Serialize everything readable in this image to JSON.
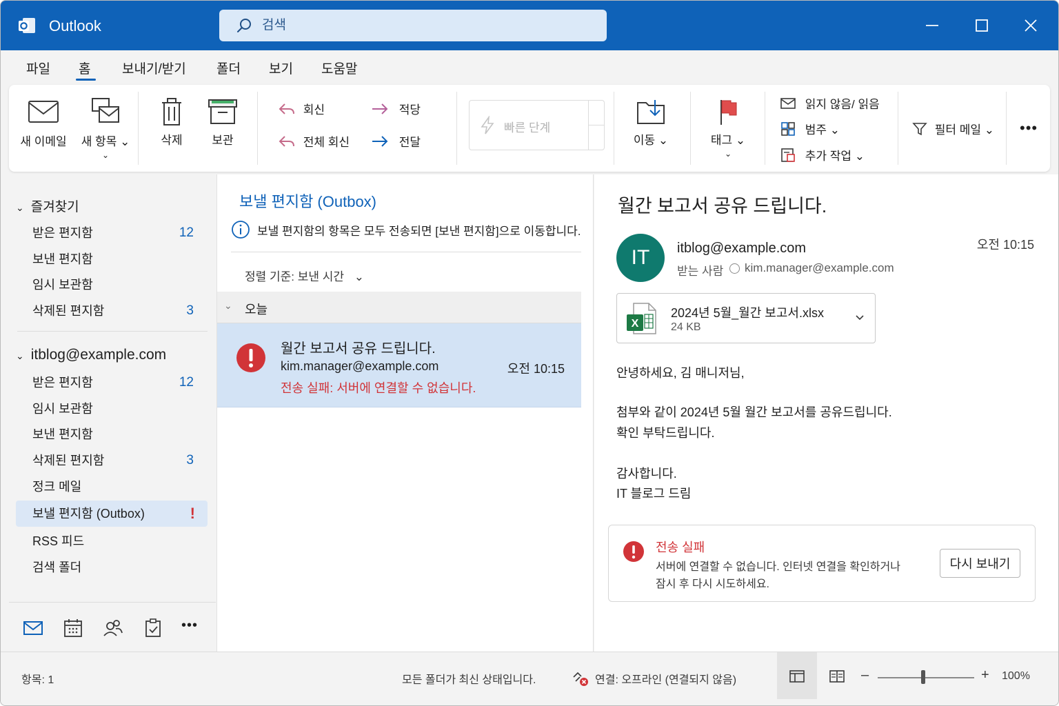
{
  "app": {
    "title": "Outlook"
  },
  "search": {
    "placeholder": "검색"
  },
  "tabs": [
    "파일",
    "홈",
    "보내기/받기",
    "폴더",
    "보기",
    "도움말"
  ],
  "ribbon": {
    "new_email": "새 이메일",
    "new_items": "새 항목",
    "delete": "삭제",
    "archive": "보관",
    "reply": "회신",
    "reply_all": "전체 회신",
    "reply_right": "적당",
    "forward": "전달",
    "quick_steps": "빠른 단계",
    "move": "이동",
    "tags": "태그",
    "unread_read": "읽지 않음/ 읽음",
    "categorize": "범주",
    "more_actions": "추가 작업",
    "filter_mail": "필터 메일"
  },
  "nav": {
    "favorites_header": "즐겨찾기",
    "favorites": [
      {
        "label": "받은 편지함",
        "count": "12"
      },
      {
        "label": "보낸 편지함",
        "count": ""
      },
      {
        "label": "임시 보관함",
        "count": ""
      },
      {
        "label": "삭제된 편지함",
        "count": "3"
      }
    ],
    "account_header": "itblog@example.com",
    "account": [
      {
        "label": "받은 편지함",
        "count": "12"
      },
      {
        "label": "임시 보관함",
        "count": ""
      },
      {
        "label": "보낸 편지함",
        "count": ""
      },
      {
        "label": "삭제된 편지함",
        "count": "3"
      },
      {
        "label": "정크 메일",
        "count": ""
      },
      {
        "label": "보낼 편지함 (Outbox)",
        "count": "!"
      },
      {
        "label": "RSS 피드",
        "count": ""
      },
      {
        "label": "검색 폴더",
        "count": ""
      }
    ]
  },
  "list": {
    "title": "보낼 편지함 (Outbox)",
    "info": "보낼 편지함의 항목은 모두 전송되면 [보낸 편지함]으로 이동합니다.",
    "sort": "정렬 기준: 보낸 시간",
    "group": "오늘",
    "message": {
      "subject": "월간 보고서 공유 드립니다.",
      "from": "kim.manager@example.com",
      "time": "오전 10:15",
      "error": "전송 실패: 서버에 연결할 수 없습니다."
    }
  },
  "reading": {
    "subject": "월간 보고서 공유 드립니다.",
    "avatar": "IT",
    "sender": "itblog@example.com",
    "to_label": "받는 사람",
    "to_addr": "kim.manager@example.com",
    "time": "오전 10:15",
    "attachment": {
      "name": "2024년 5월_월간 보고서.xlsx",
      "size": "24 KB"
    },
    "body": [
      "안녕하세요, 김 매니저님,",
      "첨부와 같이 2024년 5월 월간 보고서를 공유드립니다.",
      "확인 부탁드립니다.",
      "감사합니다.",
      "IT 블로그 드림"
    ],
    "error_title": "전송 실패",
    "error_line1": "서버에 연결할 수 없습니다. 인터넷 연결을 확인하거나",
    "error_line2": "잠시 후 다시 시도하세요.",
    "resend": "다시 보내기"
  },
  "status": {
    "items": "항목: 1",
    "folders": "모든 폴더가 최신 상태입니다.",
    "connection": "연결: 오프라인 (연결되지 않음)",
    "zoom": "100%",
    "zoom_level": 0.47
  },
  "colors": {
    "accent": "#0f62b8",
    "error": "#d13438",
    "avatar": "#0f7a6e",
    "selected_row": "#d3e3f5"
  },
  "icons": [
    "outlook-logo-icon",
    "search-icon",
    "minimize-icon",
    "maximize-icon",
    "close-icon",
    "mail-icon",
    "new-items-icon",
    "delete-icon",
    "archive-icon",
    "reply-icon",
    "reply-all-icon",
    "forward-icon",
    "lightning-icon",
    "move-icon",
    "flag-icon",
    "envelope-icon",
    "category-icon",
    "more-actions-icon",
    "filter-icon",
    "more-icon",
    "chevron-down-icon",
    "info-icon",
    "error-icon",
    "excel-icon",
    "calendar-icon",
    "people-icon",
    "tasks-icon",
    "offline-icon",
    "normal-view-icon",
    "reading-view-icon"
  ]
}
